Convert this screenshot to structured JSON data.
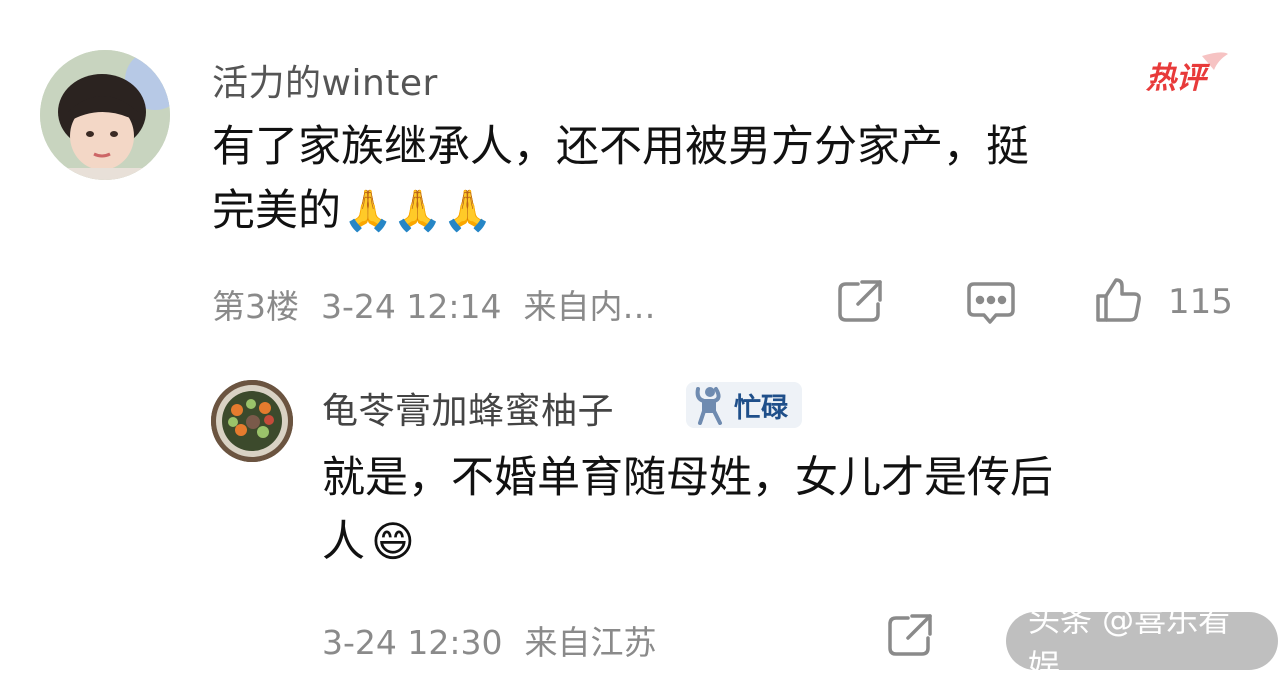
{
  "comment": {
    "username": "活力的winter",
    "badge": "热评",
    "content_line1": "有了家族继承人，还不用被男方分家产，挺",
    "content_line2": "完美的",
    "emojis": [
      "🙏",
      "🙏",
      "🙏"
    ],
    "floor": "第3楼",
    "time": "3-24 12:14",
    "location": "来自内…",
    "like_count": "115"
  },
  "reply": {
    "username": "龟苓膏加蜂蜜柚子",
    "status_badge": "忙碌",
    "content_line1": "就是，不婚单育随母姓，女儿才是传后",
    "content_line2": "人",
    "emoji": "😄",
    "time": "3-24 12:30",
    "location": "来自江苏"
  },
  "watermark": "头条 @喜乐看娱",
  "colors": {
    "badge_red": "#e83a3a",
    "meta_gray": "#8a8a8a",
    "busy_blue": "#1f4f8a"
  },
  "icons": [
    "share-icon",
    "comment-icon",
    "like-icon"
  ]
}
